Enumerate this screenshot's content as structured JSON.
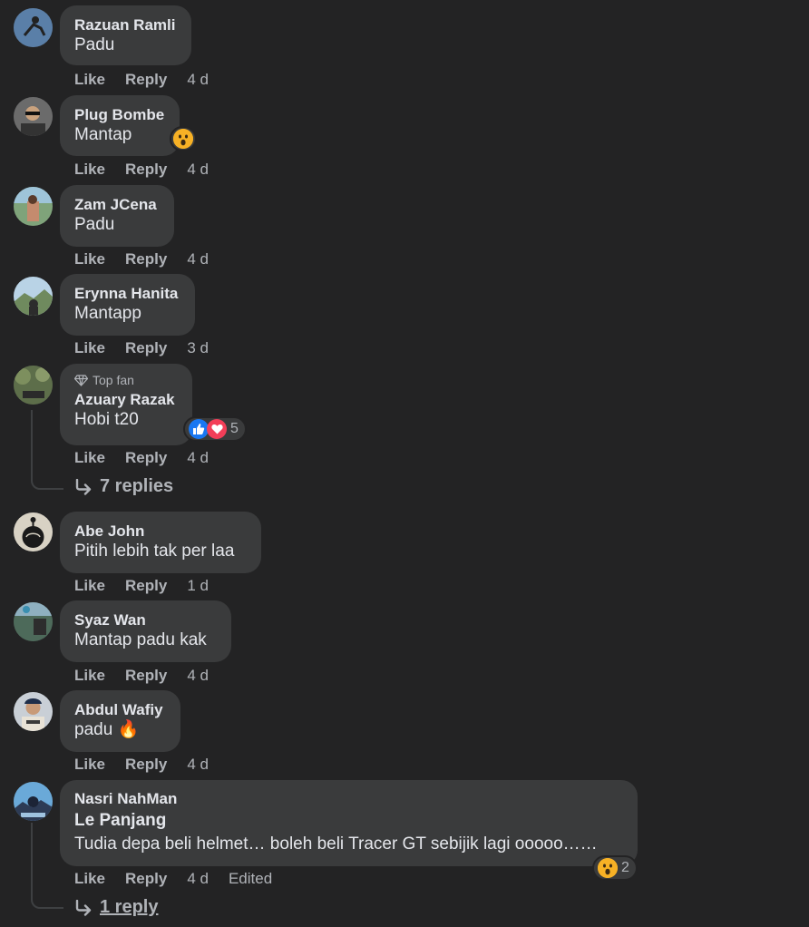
{
  "comments": [
    {
      "name": "Razuan Ramli",
      "text": "Padu",
      "like": "Like",
      "reply": "Reply",
      "time": "4 d"
    },
    {
      "name": "Plug Bombe",
      "text": "Mantap",
      "like": "Like",
      "reply": "Reply",
      "time": "4 d",
      "reaction": "wow"
    },
    {
      "name": "Zam JCena",
      "text": "Padu",
      "like": "Like",
      "reply": "Reply",
      "time": "4 d"
    },
    {
      "name": "Erynna Hanita",
      "text": "Mantapp",
      "like": "Like",
      "reply": "Reply",
      "time": "3 d"
    },
    {
      "badge": "Top fan",
      "name": "Azuary Razak",
      "text": "Hobi t20",
      "like": "Like",
      "reply": "Reply",
      "time": "4 d",
      "reactions": [
        "like",
        "love"
      ],
      "reaction_count": "5",
      "replies": "7 replies"
    },
    {
      "name": "Abe John",
      "text": "Pitih lebih tak per laa",
      "like": "Like",
      "reply": "Reply",
      "time": "1 d"
    },
    {
      "name": "Syaz Wan",
      "text": "Mantap padu kak",
      "like": "Like",
      "reply": "Reply",
      "time": "4 d"
    },
    {
      "name": "Abdul Wafiy",
      "text": "padu 🔥",
      "like": "Like",
      "reply": "Reply",
      "time": "4 d"
    },
    {
      "name": "Nasri NahMan",
      "title": "Le Panjang",
      "text": "Tudia depa beli helmet… boleh beli Tracer GT sebijik lagi ooooo……",
      "like": "Like",
      "reply": "Reply",
      "time": "4 d",
      "edited": "Edited",
      "reactions": [
        "wow"
      ],
      "reaction_count": "2",
      "replies": "1 reply"
    }
  ],
  "icons": {
    "reply_arrow": "reply-arrow-icon",
    "diamond": "diamond-icon",
    "like": "like-reaction-icon",
    "love": "love-reaction-icon",
    "wow": "wow-reaction-icon"
  },
  "colors": {
    "background": "#232324",
    "bubble": "#3a3b3c",
    "secondary_text": "#b0b3b8",
    "like_blue": "#1877f2",
    "love_red": "#f33e58",
    "wow_yellow": "#f7b125"
  }
}
